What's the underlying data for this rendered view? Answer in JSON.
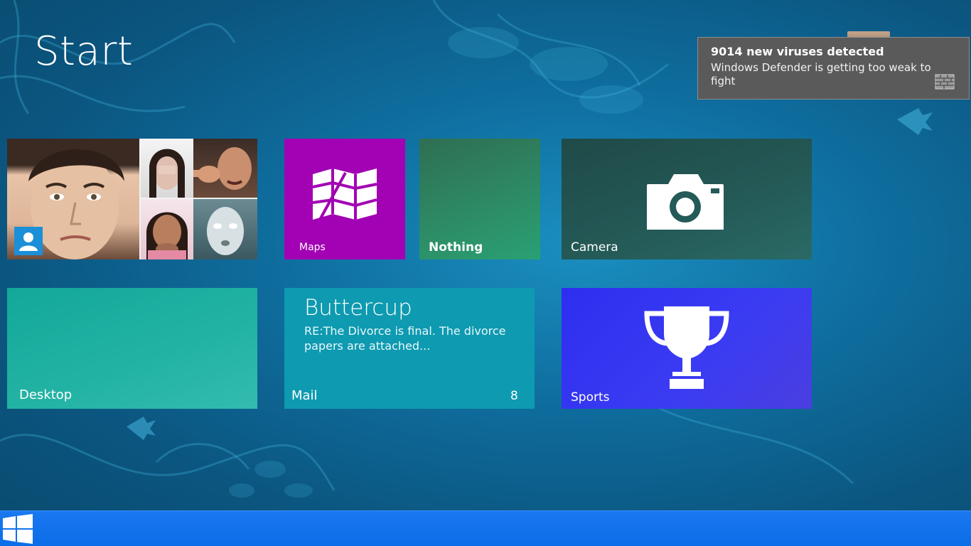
{
  "screen": {
    "title": "Start"
  },
  "notification": {
    "title": "9014 new viruses detected",
    "message": "Windows Defender is getting too weak to fight",
    "icon": "firewall-icon"
  },
  "tiles": {
    "people": {
      "icon": "person-icon"
    },
    "maps": {
      "label": "Maps",
      "icon": "map-icon"
    },
    "nothing": {
      "label": "Nothing"
    },
    "camera": {
      "label": "Camera",
      "icon": "camera-icon"
    },
    "desktop": {
      "label": "Desktop"
    },
    "mail": {
      "label": "Mail",
      "sender": "Buttercup",
      "preview": "RE:The Divorce is final. The divorce papers are attached...",
      "count": "8"
    },
    "sports": {
      "label": "Sports",
      "icon": "trophy-icon"
    }
  },
  "taskbar": {
    "start_icon": "windows-logo-icon"
  },
  "colors": {
    "maps": "#a202b3",
    "nothing": "#2d8a64",
    "camera": "#245a57",
    "desktop": "#23b3a4",
    "mail": "#0e9ab0",
    "sports": "#3b3cf2",
    "taskbar": "#0b6de8",
    "notification": "#5a5a5a"
  }
}
